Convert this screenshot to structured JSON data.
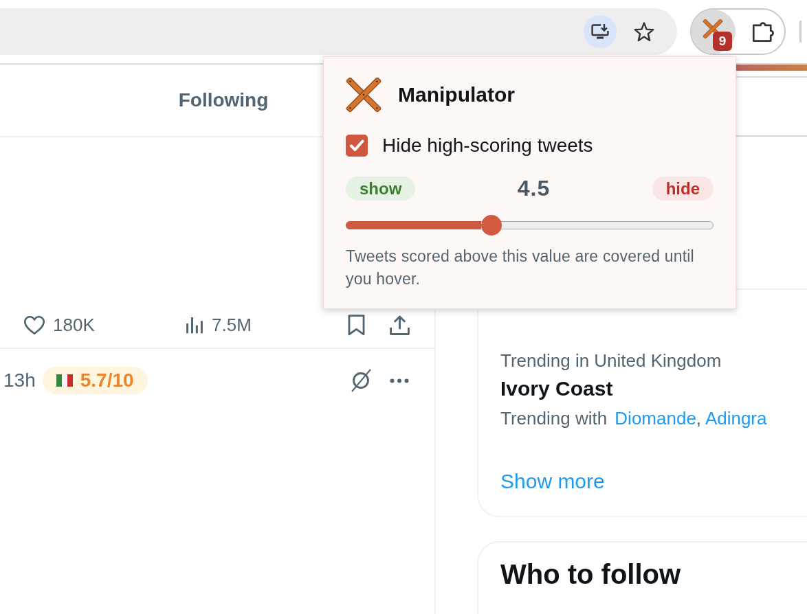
{
  "toolbar": {
    "extension": {
      "badge": "9",
      "selected": true
    }
  },
  "popup": {
    "title": "Manipulator",
    "hide_toggle": {
      "label": "Hide high-scoring tweets",
      "checked": true
    },
    "threshold": {
      "show_label": "show",
      "value": "4.5",
      "hide_label": "hide",
      "level": 0.39
    },
    "hint": "Tweets scored above this value are covered until you hover."
  },
  "feed": {
    "tabs": [
      {
        "label": "Following",
        "selected": false
      }
    ],
    "tweet_actions": {
      "likes": "180K",
      "views": "7.5M"
    },
    "next_tweet": {
      "time": "13h",
      "score": "5.7/10"
    }
  },
  "trends": {
    "trend": {
      "context": "Trending in United Kingdom",
      "name": "Ivory Coast",
      "related_label": "Trending with",
      "related": [
        "Diomande",
        "Adingra"
      ],
      "separator": ","
    },
    "show_more": "Show more"
  },
  "who_to_follow": {
    "title": "Who to follow"
  }
}
